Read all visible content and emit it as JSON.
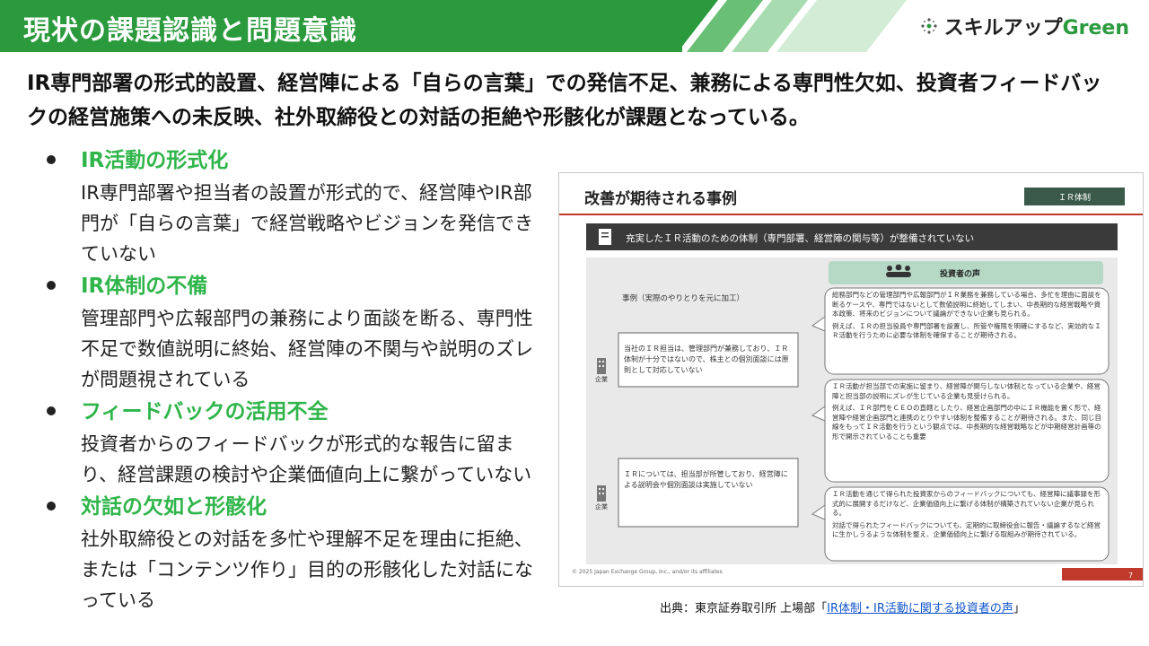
{
  "header": {
    "title": "現状の課題認識と問題意識",
    "logo": {
      "text_main": "スキルアップ",
      "text_green": "Green",
      "icon": "sparkle-dots-icon"
    }
  },
  "lead": "IR専門部署の形式的設置、経営陣による「自らの言葉」での発信不足、兼務による専門性欠如、投資者フィードバックの経営施策への未反映、社外取締役との対話の拒絶や形骸化が課題となっている。",
  "bullets": [
    {
      "title": "IR活動の形式化",
      "desc": "IR専門部署や担当者の設置が形式的で、経営陣やIR部門が「自らの言葉」で経営戦略やビジョンを発信できていない"
    },
    {
      "title": "IR体制の不備",
      "desc": "管理部門や広報部門の兼務により面談を断る、専門性不足で数値説明に終始、経営陣の不関与や説明のズレが問題視されている"
    },
    {
      "title": "フィードバックの活用不全",
      "desc": "投資者からのフィードバックが形式的な報告に留まり、経営課題の検討や企業価値向上に繋がっていない"
    },
    {
      "title": "対話の欠如と形骸化",
      "desc": "社外取締役との対話を多忙や理解不足を理由に拒絶、または「コンテンツ作り」目的の形骸化した対話になっている"
    }
  ],
  "slide": {
    "title": "改善が期待される事例",
    "tag": "ＩＲ体制",
    "banner": "充実したＩＲ活動のための体制（専門部署、経営陣の関与等）が整備されていない",
    "voices_header": "投資者の声",
    "case_label": "事例（実際のやりとりを元に加工）",
    "company_label": "企業",
    "case1": "当社のＩＲ担当は、管理部門が兼務しており、ＩＲ体制が十分ではないので、株主との個別面談には原則として対応していない",
    "case2": "ＩＲについては、担当部が所管しており、経営陣による説明会や個別面談は実施していない",
    "voice1": "総務部門などの管理部門や広報部門がＩＲ業務を兼務している場合、多忙を理由に面談を断るケースや、専門ではないとして数値説明に終始してしまい、中長期的な経営戦略や資本政策、将来のビジョンについて議論ができない企業も見られる。",
    "voice1b": "例えば、ＩＲの担当役員や専門部署を設置し、所管や権限を明確にするなど、実効的なＩＲ活動を行うために必要な体制を確保することが期待される。",
    "voice2": "ＩＲ活動が担当部での実施に留まり、経営陣が関与しない体制となっている企業や、経営陣と担当部の説明にズレが生じている企業も見受けられる。",
    "voice2b": "例えば、ＩＲ部門をＣＥＯの直轄としたり、経営企画部門の中にＩＲ機能を置く形で、経営陣や経営企画部門と連携のとりやすい体制を整備することが期待される。また、同じ目線をもってＩＲ活動を行うという観点では、中長期的な経営戦略などが中期経営計画等の形で開示されていることも重要",
    "voice3": "ＩＲ活動を通じて得られた投資家からのフィードバックについても、経営陣に議事録を形式的に展開するだけなど、企業価値向上に繋げる体制が構築されていない企業が見られる。",
    "voice3b": "対話で得られたフィードバックについても、定期的に取締役会に報告・議論するなど経営に生かしうるような体制を整え、企業価値向上に繋げる取組みが期待されている。",
    "copyright": "© 2025 Japan Exchange Group, Inc., and/or its affiliates",
    "page": "7"
  },
  "source": {
    "prefix": "出典：東京証券取引所 上場部「",
    "link": "IR体制・IR活動に関する投資者の声",
    "suffix": "」"
  }
}
